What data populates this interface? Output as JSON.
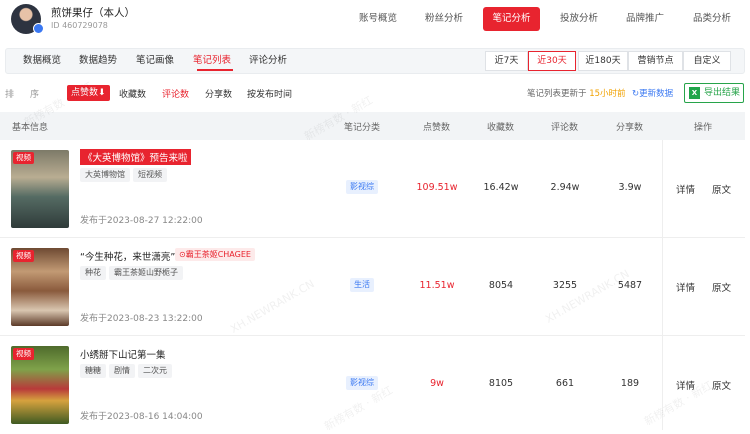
{
  "account": {
    "name": "煎饼果仔（本人）",
    "id": "ID 460729078",
    "badge": "ㅤ"
  },
  "main_tabs": [
    "账号概览",
    "粉丝分析",
    "笔记分析",
    "投放分析",
    "品牌推广",
    "品类分析"
  ],
  "sub_tabs": [
    "数据概览",
    "数据趋势",
    "笔记画像",
    "笔记列表",
    "评论分析"
  ],
  "ranges": [
    "近7天",
    "近30天",
    "近180天",
    "营销节点",
    "自定义"
  ],
  "sort": {
    "label1": "排",
    "label2": "序",
    "options": [
      "点赞数⬇",
      "收藏数",
      "评论数",
      "分享数",
      "按发布时间"
    ]
  },
  "update": {
    "prefix": "笔记列表更新于",
    "time": "15小时前",
    "refresh": "↻更新数据",
    "export": "导出结果",
    "xls": "X"
  },
  "table": {
    "headers": [
      "基本信息",
      "笔记分类",
      "点赞数",
      "收藏数",
      "评论数",
      "分享数",
      "操作"
    ],
    "rows": [
      {
        "media": "视频",
        "title": "《大英博物馆》预告来啦",
        "brand": "",
        "tags": [
          "大英博物馆",
          "短视频"
        ],
        "date": "发布于2023-08-27 12:22:00",
        "category": "影视综",
        "likes": "109.51w",
        "saves": "16.42w",
        "comments": "2.94w",
        "shares": "3.9w",
        "detail": "详情",
        "origin": "原文"
      },
      {
        "media": "视频",
        "title": "“今生种花，来世潇亮”",
        "brand": "⊙霸王茶姬CHAGEE",
        "tags": [
          "种花",
          "霸王茶姬山野栀子"
        ],
        "date": "发布于2023-08-23 13:22:00",
        "category": "生活",
        "likes": "11.51w",
        "saves": "8054",
        "comments": "3255",
        "shares": "5487",
        "detail": "详情",
        "origin": "原文"
      },
      {
        "media": "视频",
        "title": "小绣掰下山记第一集",
        "brand": "",
        "tags": [
          "糖糖",
          "剧情",
          "二次元"
        ],
        "date": "发布于2023-08-16 14:04:00",
        "category": "影视综",
        "likes": "9w",
        "saves": "8105",
        "comments": "661",
        "shares": "189",
        "detail": "详情",
        "origin": "原文"
      }
    ]
  },
  "watermarks": [
    "新榜有数 · 新红",
    "XH.NEWRANK.CN"
  ]
}
